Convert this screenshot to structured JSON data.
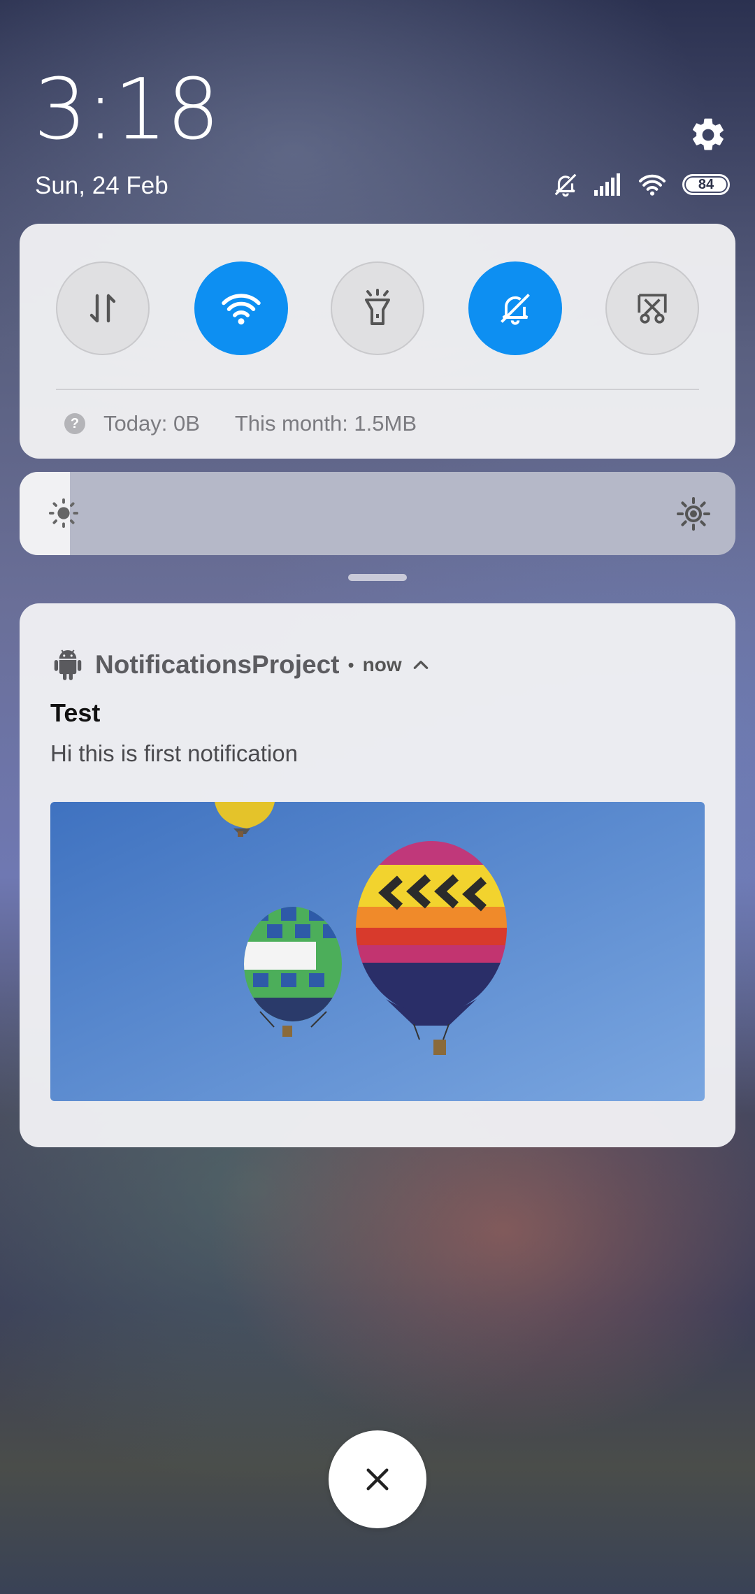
{
  "lockscreen": {
    "time": "3:18",
    "date": "Sun, 24 Feb"
  },
  "status_bar": {
    "battery_level": "84",
    "icons": [
      "mute-icon",
      "signal-icon",
      "wifi-icon",
      "battery-icon"
    ]
  },
  "quick_settings": {
    "toggles": [
      {
        "name": "mobile-data",
        "icon": "data-transfer-icon",
        "state": "off"
      },
      {
        "name": "wifi",
        "icon": "wifi-icon",
        "state": "on"
      },
      {
        "name": "flashlight",
        "icon": "flashlight-icon",
        "state": "off"
      },
      {
        "name": "silent",
        "icon": "bell-off-icon",
        "state": "on"
      },
      {
        "name": "screenshot",
        "icon": "scissors-icon",
        "state": "off"
      }
    ],
    "data_usage": {
      "today": "Today: 0B",
      "month": "This month: 1.5MB"
    },
    "brightness_level": 0.07
  },
  "notification": {
    "app_name": "NotificationsProject",
    "separator": "•",
    "time": "now",
    "title": "Test",
    "body": "Hi this is first notification",
    "image_icon": "hot-air-balloons-image"
  },
  "colors": {
    "accent": "#0d8ff2",
    "panel": "#f0f0f3",
    "toggle_off": "#e0e0e2"
  }
}
